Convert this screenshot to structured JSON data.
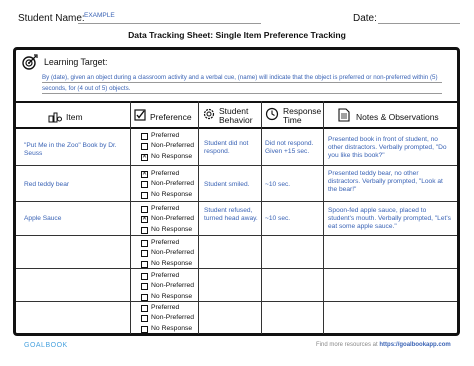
{
  "header": {
    "student_name_label": "Student Name:",
    "student_name_value": "EXAMPLE",
    "date_label": "Date:",
    "title": "Data Tracking Sheet: Single Item Preference Tracking"
  },
  "learning_target": {
    "label": "Learning Target:",
    "text": "By (date), given an object during a classroom activity and a verbal cue, (name) will indicate that the object is preferred or non-preferred within (5) seconds, for (4 out of 5) objects."
  },
  "columns": [
    {
      "label": "Item",
      "icon": "shapes-icon"
    },
    {
      "label": "Preference",
      "icon": "checkbox-icon"
    },
    {
      "label": "Student Behavior",
      "line1": "Student",
      "line2": "Behavior",
      "icon": "gear-icon"
    },
    {
      "label": "Response Time",
      "line1": "Response",
      "line2": "Time",
      "icon": "clock-icon"
    },
    {
      "label": "Notes & Observations",
      "icon": "document-icon"
    }
  ],
  "preference_options": [
    "Preferred",
    "Non-Preferred",
    "No Response"
  ],
  "rows": [
    {
      "item": "\"Put Me in the Zoo\" Book by Dr. Seuss",
      "checked": "No Response",
      "behavior": "Student did not respond.",
      "response_time": "Did not respond. Given +15 sec.",
      "notes": "Presented book in front of student, no other distractors. Verbally prompted, \"Do you like this book?\""
    },
    {
      "item": "Red teddy bear",
      "checked": "Preferred",
      "behavior": "Student smiled.",
      "response_time": "~10 sec.",
      "notes": "Presented teddy bear, no other distractors. Verbally prompted, \"Look at the bear!\""
    },
    {
      "item": "Apple Sauce",
      "checked": "Non-Preferred",
      "behavior": "Student refused, turned head away.",
      "response_time": "~10 sec.",
      "notes": "Spoon-fed apple sauce, placed to student's mouth. Verbally prompted, \"Let's eat some apple sauce.\""
    },
    {
      "item": "",
      "checked": "",
      "behavior": "",
      "response_time": "",
      "notes": ""
    },
    {
      "item": "",
      "checked": "",
      "behavior": "",
      "response_time": "",
      "notes": ""
    },
    {
      "item": "",
      "checked": "",
      "behavior": "",
      "response_time": "",
      "notes": ""
    }
  ],
  "footer": {
    "logo_text": "GOALBOOK",
    "resources_label": "Find more resources at",
    "resources_url": "https://goalbookapp.com"
  }
}
